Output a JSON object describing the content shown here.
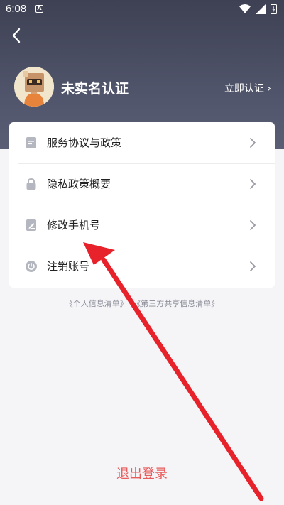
{
  "status_bar": {
    "time": "6:08",
    "notification_badge": "A"
  },
  "header": {
    "back_icon": "chevron-left-icon"
  },
  "profile": {
    "name": "未实名认证",
    "verify_label": "立即认证 ›"
  },
  "menu": {
    "items": [
      {
        "label": "服务协议与政策",
        "icon": "document-icon"
      },
      {
        "label": "隐私政策概要",
        "icon": "lock-icon"
      },
      {
        "label": "修改手机号",
        "icon": "edit-phone-icon"
      },
      {
        "label": "注销账号",
        "icon": "power-icon"
      }
    ]
  },
  "links": {
    "personal_info": "《个人信息清单》",
    "third_party": "《第三方共享信息清单》"
  },
  "logout": {
    "label": "退出登录"
  },
  "colors": {
    "header": "#3e4153",
    "logout": "#e85b5b",
    "arrow": "#e8222a"
  }
}
